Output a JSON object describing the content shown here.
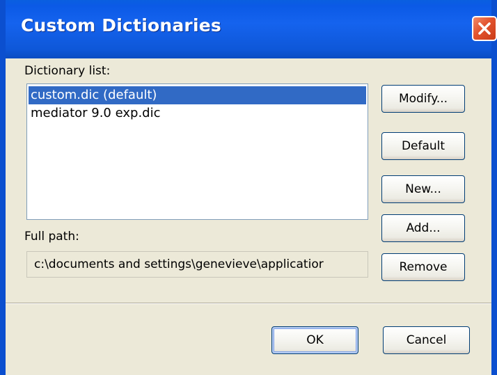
{
  "window": {
    "title": "Custom Dictionaries",
    "close_icon": "close-icon"
  },
  "dictionary_list": {
    "label": "Dictionary list:",
    "items": [
      {
        "label": "custom.dic (default)",
        "selected": true
      },
      {
        "label": "mediator 9.0 exp.dic",
        "selected": false
      }
    ]
  },
  "full_path": {
    "label": "Full path:",
    "value": "c:\\documents and settings\\genevieve\\applicatior"
  },
  "buttons": {
    "modify": "Modify...",
    "default": "Default",
    "new": "New...",
    "add": "Add...",
    "remove": "Remove",
    "ok": "OK",
    "cancel": "Cancel"
  },
  "colors": {
    "titlebar": "#0b5ae6",
    "close_button": "#e2532e",
    "selection": "#316ac5",
    "dialog_background": "#ece9d8"
  }
}
